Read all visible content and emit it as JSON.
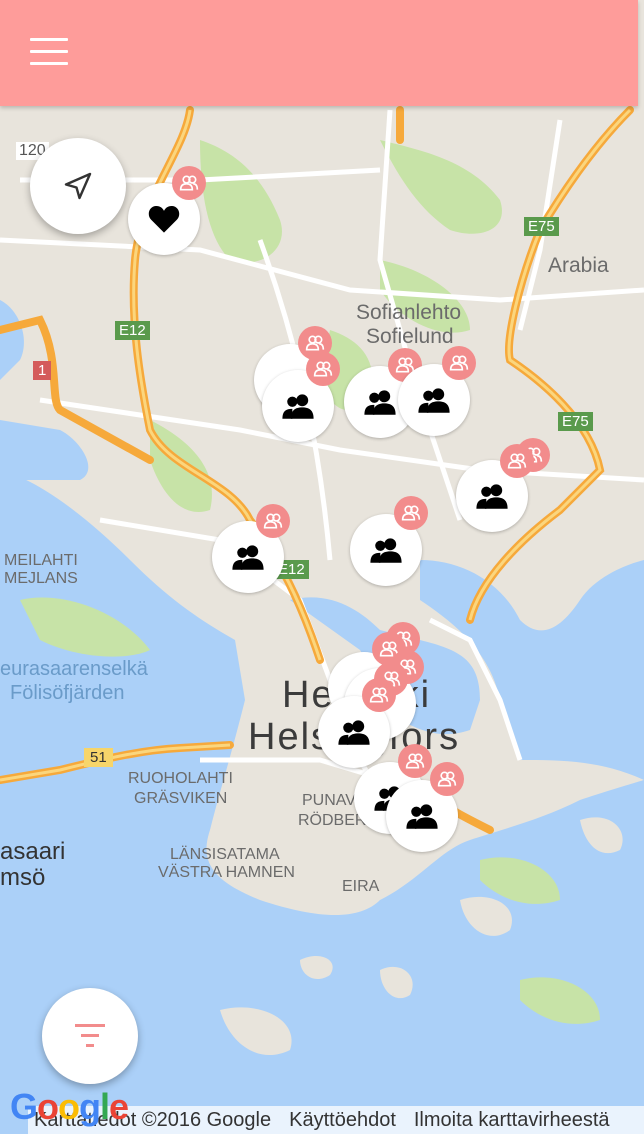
{
  "header": {
    "menu_icon": "hamburger-menu-icon",
    "color": "#fe9c9a"
  },
  "map": {
    "labels": {
      "road_120": "120",
      "e75_north": "E75",
      "arabia": "Arabia",
      "sofianlehto": "Sofianlehto",
      "sofielund": "Sofielund",
      "e12_north": "E12",
      "road_1": "1",
      "e75_south": "E75",
      "meilahti": "MEILAHTI",
      "mejlans": "MEJLANS",
      "e12_south": "E12",
      "seurasaarenselka": "eurasaarenselkä",
      "folisofjarden": "Fölisöfjärden",
      "helsinki": "Helsinki",
      "helsingfors": "Helsingfors",
      "road_51": "51",
      "ruoholahti": "RUOHOLAHTI",
      "grasviken": "GRÄSVIKEN",
      "punavuori": "PUNAV",
      "rodbergen": "RÖDBER",
      "lansisatama": "LÄNSISATAMA",
      "vastra_hamnen": "VÄSTRA HAMNEN",
      "eira": "EIRA",
      "lauttasaari": "asaari",
      "drumso": "msö"
    },
    "colors": {
      "land": "#e8e4dc",
      "water": "#abd0f8",
      "park": "#c7e3a7",
      "road": "#ffffff",
      "highway": "#f6a93b"
    }
  },
  "buttons": {
    "locate_icon": "navigation-arrow-icon",
    "filter_icon": "filter-icon"
  },
  "markers": {
    "favorite_icon": "heart-icon",
    "group_icon": "group-icon",
    "badge_icon": "group-badge-icon",
    "badge_color": "#f28c8c"
  },
  "footer": {
    "google_logo": "Google",
    "map_data": "Karttatiedot ©2016 Google",
    "terms": "Käyttöehdot",
    "report": "Ilmoita karttavirheestä"
  }
}
